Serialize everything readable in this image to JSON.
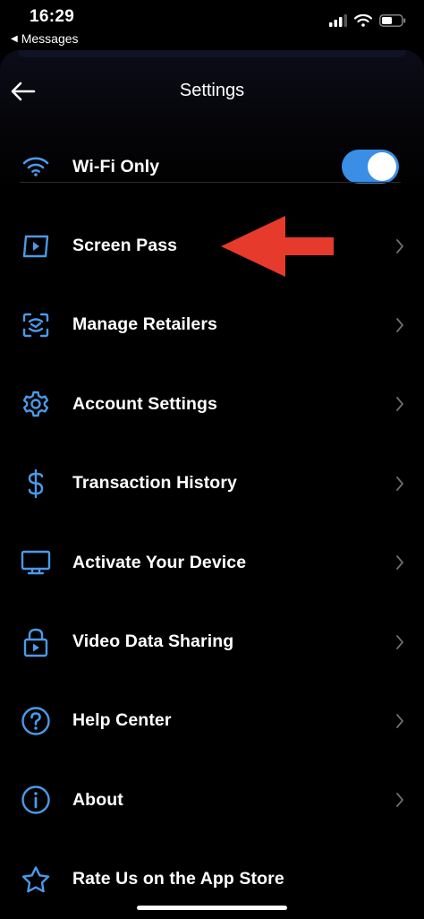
{
  "status_bar": {
    "time": "16:29",
    "back_app": "Messages",
    "back_glyph": "◀"
  },
  "header": {
    "title": "Settings"
  },
  "settings": [
    {
      "label": "Wi-Fi Only",
      "icon": "wifi-icon",
      "toggle": true
    },
    {
      "label": "Screen Pass",
      "icon": "screen-pass-icon"
    },
    {
      "label": "Manage Retailers",
      "icon": "retailers-icon"
    },
    {
      "label": "Account Settings",
      "icon": "gear-icon"
    },
    {
      "label": "Transaction History",
      "icon": "dollar-icon"
    },
    {
      "label": "Activate Your Device",
      "icon": "monitor-icon"
    },
    {
      "label": "Video Data Sharing",
      "icon": "lock-play-icon"
    },
    {
      "label": "Help Center",
      "icon": "question-icon"
    },
    {
      "label": "About",
      "icon": "info-icon"
    },
    {
      "label": "Rate Us on the App Store",
      "icon": "star-icon"
    }
  ],
  "colors": {
    "accent": "#3a8ee6",
    "icon": "#4a9ae8",
    "annotation_arrow": "#e53a2c",
    "background": "#000000"
  }
}
